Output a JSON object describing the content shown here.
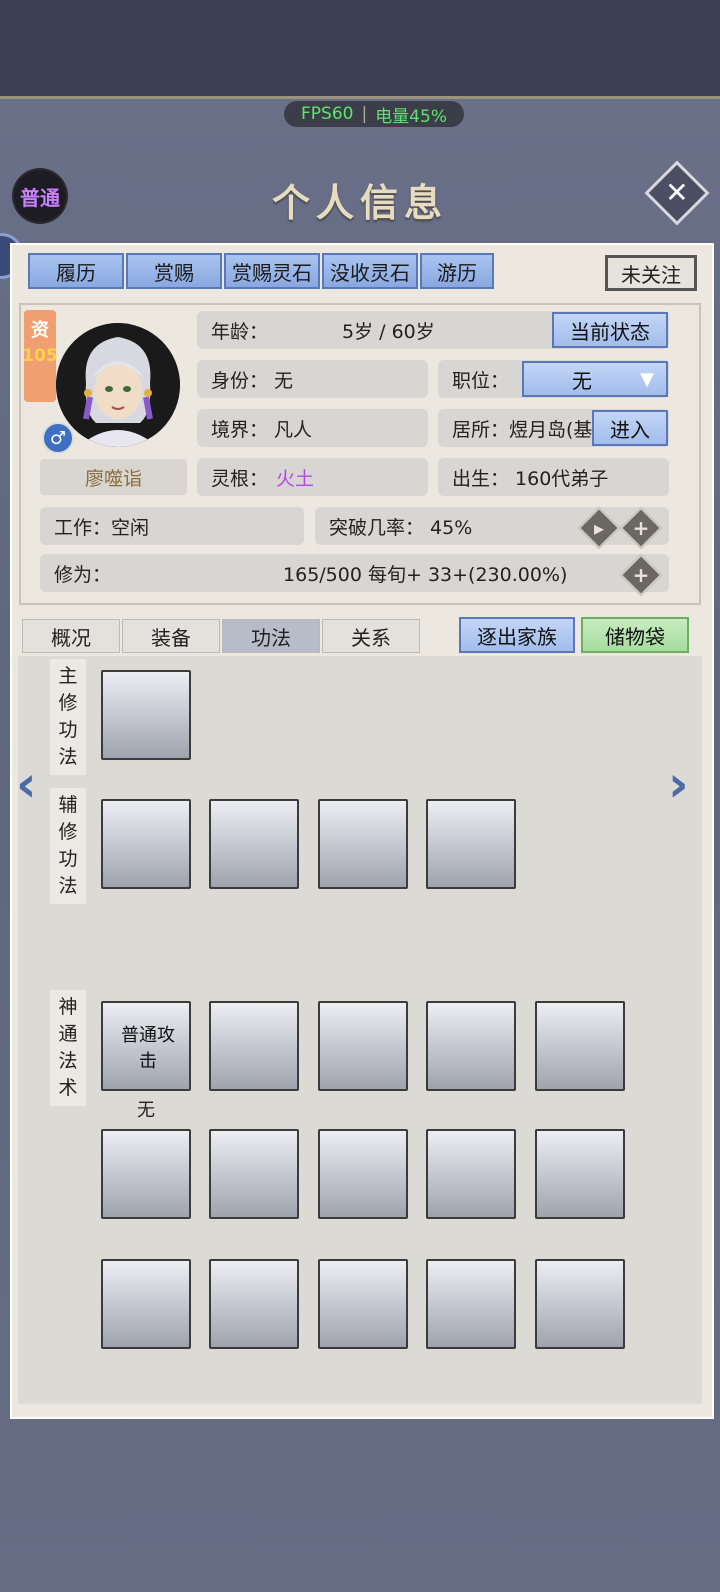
{
  "status_bar": {
    "fps": "FPS60",
    "battery": "电量45%"
  },
  "header": {
    "rank_badge": "普通",
    "title": "个人信息"
  },
  "top_tabs": [
    "履历",
    "赏赐",
    "赏赐灵石",
    "没收灵石",
    "游历"
  ],
  "follow_button": "未关注",
  "character": {
    "aptitude_label": "资",
    "aptitude_value": "105",
    "gender_symbol": "♂",
    "name": "廖噬诣",
    "age_label": "年龄：",
    "age_value": "5岁 / 60岁",
    "current_state_button": "当前状态",
    "identity": "身份：  无",
    "position_label": "职位：",
    "position_value": "无",
    "realm": "境界：  凡人",
    "residence": "居所：煜月岛(基",
    "enter_button": "进入",
    "spirit_root_label": "灵根：",
    "spirit_root_value": "火土",
    "birth": "出生：  160代弟子",
    "work": "工作：空闲",
    "breakthrough": "突破几率：  45%",
    "cultivation_label": "修为：",
    "cultivation_value": "165/500  每旬+  33+(230.00%)"
  },
  "mid_tabs": [
    "概况",
    "装备",
    "功法",
    "关系"
  ],
  "expel_button": "逐出家族",
  "storage_bag_button": "储物袋",
  "sections": {
    "main_method": [
      "主",
      "修",
      "功",
      "法"
    ],
    "aux_method": [
      "辅",
      "修",
      "功",
      "法"
    ],
    "divine_arts": [
      "神",
      "通",
      "法",
      "术"
    ]
  },
  "first_art": {
    "name": "普通攻击",
    "caption": "无"
  },
  "colors": {
    "accent_blue": "#a3bceb",
    "purple": "#b04ce0",
    "green_fps": "#5fe36e"
  }
}
